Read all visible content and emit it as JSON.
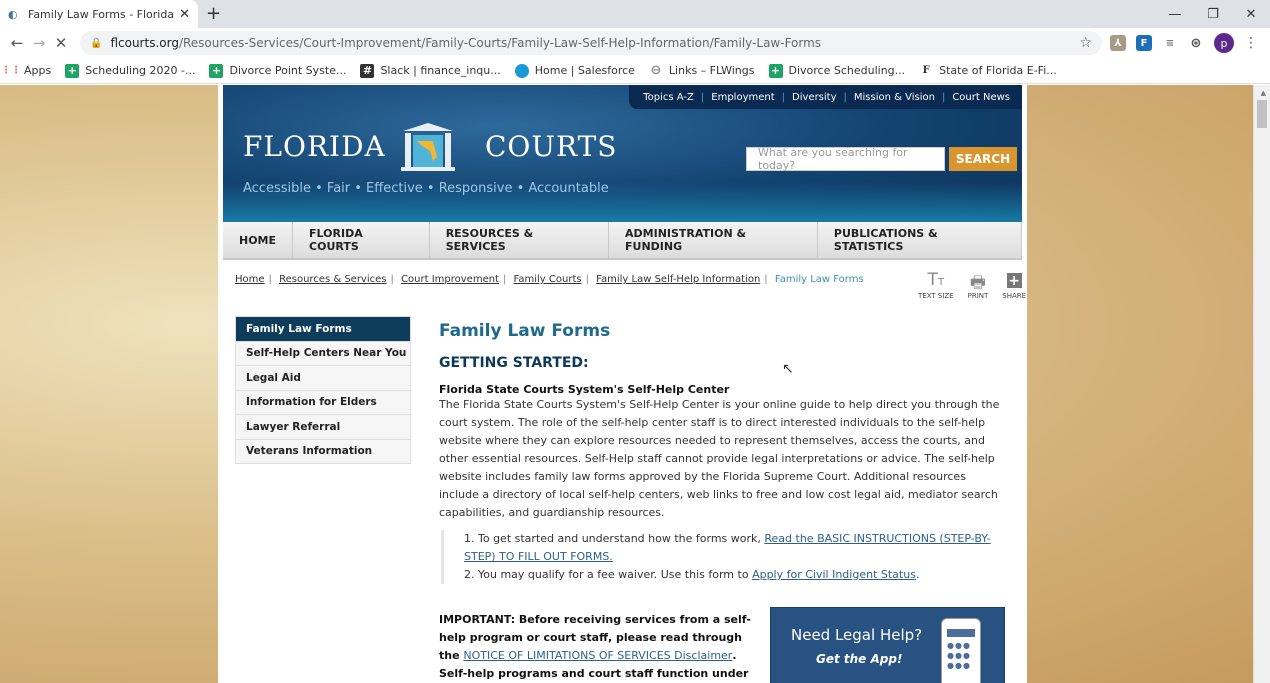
{
  "browser": {
    "tab_title": "Family Law Forms - Florida Court",
    "url_host": "flcourts.org",
    "url_path": "/Resources-Services/Court-Improvement/Family-Courts/Family-Law-Self-Help-Information/Family-Law-Forms",
    "profile_initial": "p",
    "bookmarks": [
      "Apps",
      "Scheduling 2020 -...",
      "Divorce Point Syste...",
      "Slack | finance_inqu...",
      "Home | Salesforce",
      "Links – FLWings",
      "Divorce Scheduling...",
      "State of Florida E-Fi..."
    ]
  },
  "site": {
    "top_links": [
      "Topics A-Z",
      "Employment",
      "Diversity",
      "Mission & Vision",
      "Court News"
    ],
    "logo_left": "FLORIDA",
    "logo_right": "COURTS",
    "tagline": "Accessible • Fair • Effective • Responsive • Accountable",
    "search_placeholder": "What are you searching for today?",
    "search_button": "SEARCH",
    "main_nav": [
      "HOME",
      "FLORIDA COURTS",
      "RESOURCES & SERVICES",
      "ADMINISTRATION & FUNDING",
      "PUBLICATIONS & STATISTICS"
    ],
    "breadcrumb": [
      "Home",
      "Resources & Services",
      "Court Improvement",
      "Family Courts",
      "Family Law Self-Help Information"
    ],
    "breadcrumb_current": "Family Law Forms",
    "tools": [
      "TEXT SIZE",
      "PRINT",
      "SHARE"
    ],
    "side_nav": [
      "Family Law Forms",
      "Self-Help Centers Near You",
      "Legal Aid",
      "Information for Elders",
      "Lawyer Referral",
      "Veterans Information"
    ]
  },
  "content": {
    "title": "Family Law Forms",
    "subtitle": "GETTING STARTED:",
    "section_heading": "Florida State Courts System's Self-Help Center",
    "paragraph": "The Florida State Courts System's Self-Help Center is your online guide to help direct you through the court system. The role of the self-help center staff is to direct interested individuals to the self-help website where they can explore resources needed to represent themselves, access the courts, and other essential resources. Self-Help staff cannot provide legal interpretations or advice. The self-help website includes family law forms approved by the Florida Supreme Court. Additional resources include a directory of local self-help centers, web links to free and low cost legal aid, mediator search capabilities, and guardianship resources.",
    "step1_text": "To get started and understand how the forms work, ",
    "step1_link": "Read the BASIC INSTRUCTIONS (STEP-BY-STEP) TO FILL OUT FORMS.",
    "step2_text": "You may qualify for a fee waiver. Use this form to ",
    "step2_link": "Apply for Civil Indigent Status",
    "important_text": "IMPORTANT: Before receiving services from a self-help program or court staff, please read through the ",
    "important_link": "NOTICE OF LIMITATIONS OF SERVICES Disclaimer",
    "next_heading": "Self-help programs and court staff function under",
    "app_title": "Need Legal Help?",
    "app_subtitle": "Get the App!"
  }
}
